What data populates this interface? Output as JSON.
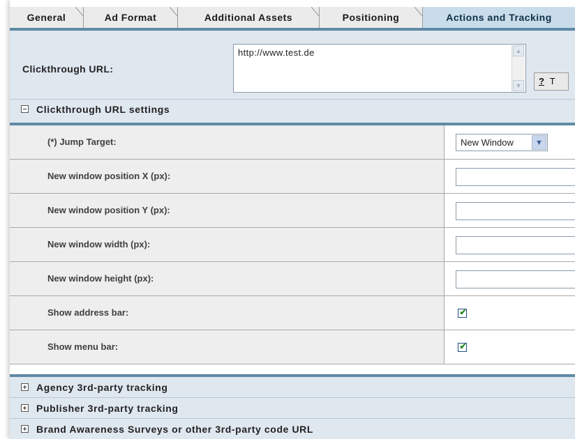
{
  "tabs": [
    {
      "label": "General"
    },
    {
      "label": "Ad Format"
    },
    {
      "label": "Additional Assets"
    },
    {
      "label": "Positioning"
    },
    {
      "label": "Actions and Tracking"
    }
  ],
  "active_tab": "Actions and Tracking",
  "clickthrough": {
    "label": "Clickthrough URL:",
    "value": "http://www.test.de",
    "help_label": "?",
    "help_text_cut": "T"
  },
  "sections": {
    "clickthrough_settings": "Clickthrough URL settings",
    "agency": "Agency 3rd-party tracking",
    "publisher": "Publisher 3rd-party tracking",
    "brand": "Brand Awareness Surveys or other 3rd-party code URL"
  },
  "settings": {
    "jump_target": {
      "label": "(*) Jump Target:",
      "value": "New Window"
    },
    "pos_x": {
      "label": "New window position X (px):",
      "value": ""
    },
    "pos_y": {
      "label": "New window position Y (px):",
      "value": ""
    },
    "width": {
      "label": "New window width (px):",
      "value": ""
    },
    "height": {
      "label": "New window height (px):",
      "value": ""
    },
    "address_bar": {
      "label": "Show address bar:",
      "checked": true
    },
    "menu_bar": {
      "label": "Show menu bar:",
      "checked": true
    }
  },
  "icons": {
    "collapse": "minus-box-icon",
    "expand": "plus-box-icon",
    "dropdown": "chevron-down-icon",
    "check": "checkmark-icon"
  },
  "colors": {
    "accent_line": "#5f8aa5",
    "active_tab": "#c8dcea",
    "header_bg": "#dfe7ef",
    "check": "#1f8a22"
  }
}
